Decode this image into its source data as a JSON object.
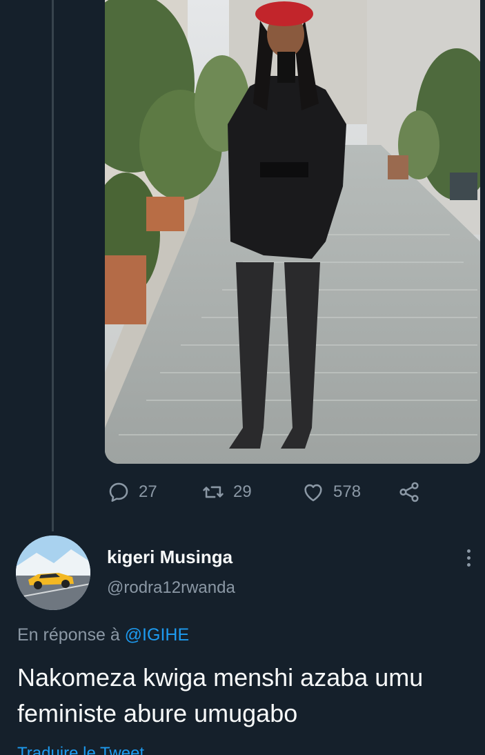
{
  "colors": {
    "background": "#15202b",
    "muted": "#8b98a5",
    "accent": "#1d9bf0",
    "thread_line": "#38444d"
  },
  "parent_tweet": {
    "actions": [
      {
        "icon": "reply-icon",
        "count": "27"
      },
      {
        "icon": "retweet-icon",
        "count": "29"
      },
      {
        "icon": "heart-icon",
        "count": "578"
      },
      {
        "icon": "share-icon"
      }
    ]
  },
  "reply": {
    "display_name": "kigeri Musinga",
    "handle": "@rodra12rwanda",
    "in_reply_prefix": "En réponse à",
    "in_reply_mention": "@IGIHE",
    "text": "Nakomeza kwiga menshi azaba umu feministe abure umugabo",
    "translate_label": "Traduire le Tweet",
    "more_icon": "more-vertical-icon"
  }
}
